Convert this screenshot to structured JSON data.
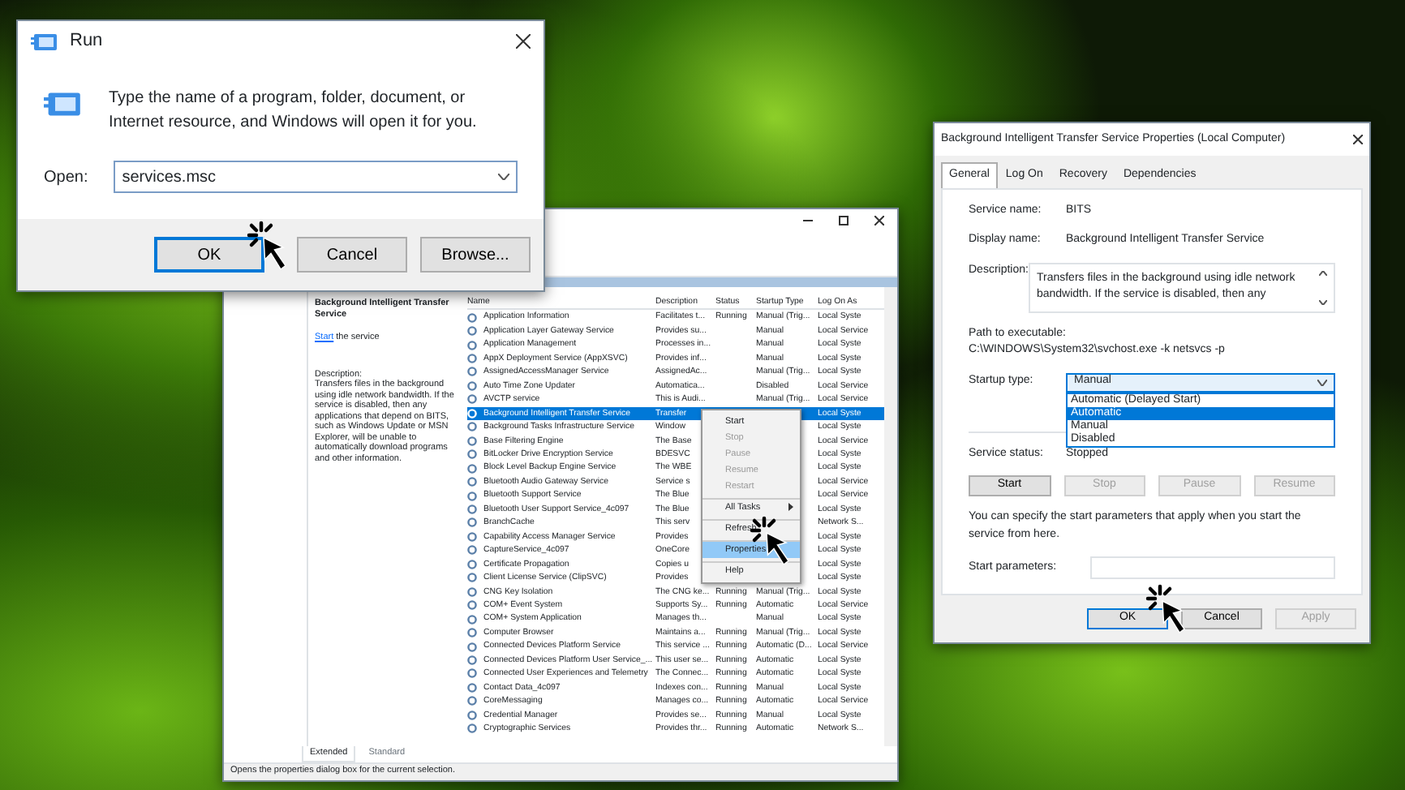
{
  "run_dialog": {
    "title": "Run",
    "message": "Type the name of a program, folder, document, or Internet resource, and Windows will open it for you.",
    "open_label": "Open:",
    "open_value": "services.msc",
    "buttons": [
      {
        "label": "OK",
        "default": true
      },
      {
        "label": "Cancel",
        "default": false
      },
      {
        "label": "Browse...",
        "default": false
      }
    ]
  },
  "services_window": {
    "details": {
      "title": "Background Intelligent Transfer Service",
      "action_link": "Start",
      "action_text": " the service",
      "description_label": "Description:",
      "description": "Transfers files in the background using idle network bandwidth. If the service is disabled, then any applications that depend on BITS, such as Windows Update or MSN Explorer, will be unable to automatically download programs and other information."
    },
    "columns": [
      "Name",
      "Description",
      "Status",
      "Startup Type",
      "Log On As"
    ],
    "rows": [
      {
        "name": "Application Information",
        "description": "Facilitates t...",
        "status": "Running",
        "startup_type": "Manual (Trig...",
        "log_on_as": "Local Syste",
        "selected": false
      },
      {
        "name": "Application Layer Gateway Service",
        "description": "Provides su...",
        "status": "",
        "startup_type": "Manual",
        "log_on_as": "Local Service",
        "selected": false
      },
      {
        "name": "Application Management",
        "description": "Processes in...",
        "status": "",
        "startup_type": "Manual",
        "log_on_as": "Local Syste",
        "selected": false
      },
      {
        "name": "AppX Deployment Service (AppXSVC)",
        "description": "Provides inf...",
        "status": "",
        "startup_type": "Manual",
        "log_on_as": "Local Syste",
        "selected": false
      },
      {
        "name": "AssignedAccessManager Service",
        "description": "AssignedAc...",
        "status": "",
        "startup_type": "Manual (Trig...",
        "log_on_as": "Local Syste",
        "selected": false
      },
      {
        "name": "Auto Time Zone Updater",
        "description": "Automatica...",
        "status": "",
        "startup_type": "Disabled",
        "log_on_as": "Local Service",
        "selected": false
      },
      {
        "name": "AVCTP service",
        "description": "This is Audi...",
        "status": "",
        "startup_type": "Manual (Trig...",
        "log_on_as": "Local Service",
        "selected": false
      },
      {
        "name": "Background Intelligent Transfer Service",
        "description": "Transfer",
        "status": "",
        "startup_type": "",
        "log_on_as": "Local Syste",
        "selected": true
      },
      {
        "name": "Background Tasks Infrastructure Service",
        "description": "Window",
        "status": "",
        "startup_type": "",
        "log_on_as": "Local Syste",
        "selected": false
      },
      {
        "name": "Base Filtering Engine",
        "description": "The Base",
        "status": "",
        "startup_type": "",
        "log_on_as": "Local Service",
        "selected": false
      },
      {
        "name": "BitLocker Drive Encryption Service",
        "description": "BDESVC",
        "status": "",
        "startup_type": "",
        "log_on_as": "Local Syste",
        "selected": false
      },
      {
        "name": "Block Level Backup Engine Service",
        "description": "The WBE",
        "status": "",
        "startup_type": "",
        "log_on_as": "Local Syste",
        "selected": false
      },
      {
        "name": "Bluetooth Audio Gateway Service",
        "description": "Service s",
        "status": "",
        "startup_type": "",
        "log_on_as": "Local Service",
        "selected": false
      },
      {
        "name": "Bluetooth Support Service",
        "description": "The Blue",
        "status": "",
        "startup_type": "",
        "log_on_as": "Local Service",
        "selected": false
      },
      {
        "name": "Bluetooth User Support Service_4c097",
        "description": "The Blue",
        "status": "",
        "startup_type": "",
        "log_on_as": "Local Syste",
        "selected": false
      },
      {
        "name": "BranchCache",
        "description": "This serv",
        "status": "",
        "startup_type": "",
        "log_on_as": "Network S...",
        "selected": false
      },
      {
        "name": "Capability Access Manager Service",
        "description": "Provides",
        "status": "",
        "startup_type": "",
        "log_on_as": "Local Syste",
        "selected": false
      },
      {
        "name": "CaptureService_4c097",
        "description": "OneCore",
        "status": "",
        "startup_type": "",
        "log_on_as": "Local Syste",
        "selected": false
      },
      {
        "name": "Certificate Propagation",
        "description": "Copies u",
        "status": "",
        "startup_type": "",
        "log_on_as": "Local Syste",
        "selected": false
      },
      {
        "name": "Client License Service (ClipSVC)",
        "description": "Provides",
        "status": "",
        "startup_type": "",
        "log_on_as": "Local Syste",
        "selected": false
      },
      {
        "name": "CNG Key Isolation",
        "description": "The CNG ke...",
        "status": "Running",
        "startup_type": "Manual (Trig...",
        "log_on_as": "Local Syste",
        "selected": false
      },
      {
        "name": "COM+ Event System",
        "description": "Supports Sy...",
        "status": "Running",
        "startup_type": "Automatic",
        "log_on_as": "Local Service",
        "selected": false
      },
      {
        "name": "COM+ System Application",
        "description": "Manages th...",
        "status": "",
        "startup_type": "Manual",
        "log_on_as": "Local Syste",
        "selected": false
      },
      {
        "name": "Computer Browser",
        "description": "Maintains a...",
        "status": "Running",
        "startup_type": "Manual (Trig...",
        "log_on_as": "Local Syste",
        "selected": false
      },
      {
        "name": "Connected Devices Platform Service",
        "description": "This service ...",
        "status": "Running",
        "startup_type": "Automatic (D...",
        "log_on_as": "Local Service",
        "selected": false
      },
      {
        "name": "Connected Devices Platform User Service_...",
        "description": "This user se...",
        "status": "Running",
        "startup_type": "Automatic",
        "log_on_as": "Local Syste",
        "selected": false
      },
      {
        "name": "Connected User Experiences and Telemetry",
        "description": "The Connec...",
        "status": "Running",
        "startup_type": "Automatic",
        "log_on_as": "Local Syste",
        "selected": false
      },
      {
        "name": "Contact Data_4c097",
        "description": "Indexes con...",
        "status": "Running",
        "startup_type": "Manual",
        "log_on_as": "Local Syste",
        "selected": false
      },
      {
        "name": "CoreMessaging",
        "description": "Manages co...",
        "status": "Running",
        "startup_type": "Automatic",
        "log_on_as": "Local Service",
        "selected": false
      },
      {
        "name": "Credential Manager",
        "description": "Provides se...",
        "status": "Running",
        "startup_type": "Manual",
        "log_on_as": "Local Syste",
        "selected": false
      },
      {
        "name": "Cryptographic Services",
        "description": "Provides thr...",
        "status": "Running",
        "startup_type": "Automatic",
        "log_on_as": "Network S...",
        "selected": false
      }
    ],
    "context_menu": [
      {
        "label": "Start",
        "disabled": false,
        "selected": false,
        "submenu": false,
        "separator_before": false
      },
      {
        "label": "Stop",
        "disabled": true,
        "selected": false,
        "submenu": false,
        "separator_before": false
      },
      {
        "label": "Pause",
        "disabled": true,
        "selected": false,
        "submenu": false,
        "separator_before": false
      },
      {
        "label": "Resume",
        "disabled": true,
        "selected": false,
        "submenu": false,
        "separator_before": false
      },
      {
        "label": "Restart",
        "disabled": true,
        "selected": false,
        "submenu": false,
        "separator_before": false
      },
      {
        "label": "All Tasks",
        "disabled": false,
        "selected": false,
        "submenu": true,
        "separator_before": true
      },
      {
        "label": "Refresh",
        "disabled": false,
        "selected": false,
        "submenu": false,
        "separator_before": true
      },
      {
        "label": "Properties",
        "disabled": false,
        "selected": true,
        "submenu": false,
        "separator_before": true
      },
      {
        "label": "Help",
        "disabled": false,
        "selected": false,
        "submenu": false,
        "separator_before": true
      }
    ],
    "view_tabs": [
      {
        "label": "Extended",
        "selected": true
      },
      {
        "label": "Standard",
        "selected": false
      }
    ],
    "status_bar": "Opens the properties dialog box for the current selection."
  },
  "properties_dialog": {
    "title": "Background Intelligent Transfer Service Properties (Local Computer)",
    "tabs": [
      {
        "label": "General",
        "selected": true
      },
      {
        "label": "Log On",
        "selected": false
      },
      {
        "label": "Recovery",
        "selected": false
      },
      {
        "label": "Dependencies",
        "selected": false
      }
    ],
    "service_name_label": "Service name:",
    "service_name": "BITS",
    "display_name_label": "Display name:",
    "display_name": "Background Intelligent Transfer Service",
    "description_label": "Description:",
    "description": "Transfers files in the background using idle network bandwidth. If the service is disabled, then any",
    "path_label": "Path to executable:",
    "path": "C:\\WINDOWS\\System32\\svchost.exe -k netsvcs -p",
    "startup_type_label": "Startup type:",
    "startup_type": "Manual",
    "startup_options": [
      {
        "label": "Automatic (Delayed Start)",
        "selected": false
      },
      {
        "label": "Automatic",
        "selected": true
      },
      {
        "label": "Manual",
        "selected": false
      },
      {
        "label": "Disabled",
        "selected": false
      }
    ],
    "service_status_label": "Service status:",
    "service_status": "Stopped",
    "control_buttons": [
      {
        "label": "Start",
        "disabled": false
      },
      {
        "label": "Stop",
        "disabled": true
      },
      {
        "label": "Pause",
        "disabled": true
      },
      {
        "label": "Resume",
        "disabled": true
      }
    ],
    "hint": "You can specify the start parameters that apply when you start the service from here.",
    "start_parameters_label": "Start parameters:",
    "footer_buttons": [
      {
        "label": "OK",
        "disabled": false,
        "default": true
      },
      {
        "label": "Cancel",
        "disabled": false,
        "default": false
      },
      {
        "label": "Apply",
        "disabled": true,
        "default": false
      }
    ]
  }
}
